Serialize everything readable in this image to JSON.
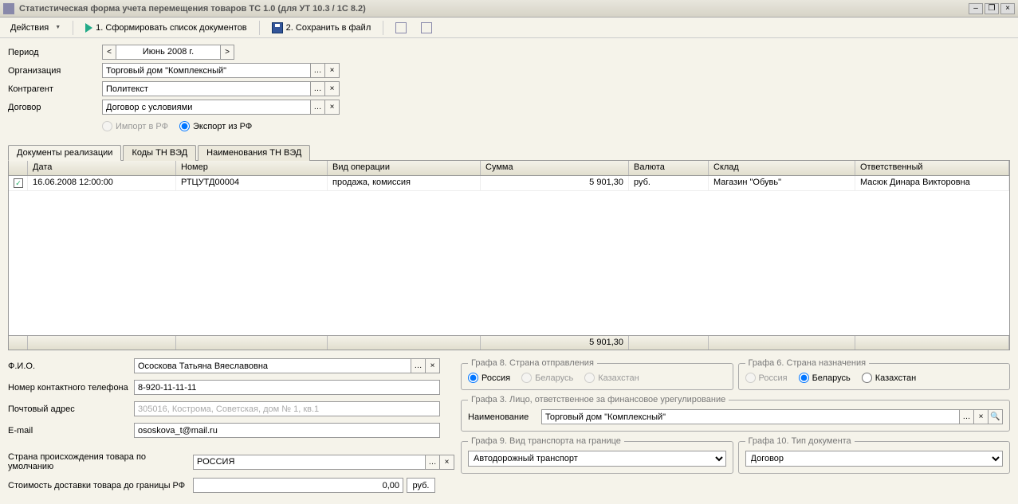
{
  "title": "Статистическая форма учета перемещения товаров ТС 1.0 (для УТ 10.3 / 1С 8.2)",
  "toolbar": {
    "actions": "Действия",
    "btn1": "1. Сформировать список документов",
    "btn2": "2. Сохранить в файл"
  },
  "period": {
    "label": "Период",
    "value": "Июнь 2008 г."
  },
  "org": {
    "label": "Организация",
    "value": "Торговый дом \"Комплексный\""
  },
  "contr": {
    "label": "Контрагент",
    "value": "Политекст"
  },
  "contract": {
    "label": "Договор",
    "value": "Договор с условиями"
  },
  "dir": {
    "import": "Импорт в РФ",
    "export": "Экспорт из РФ"
  },
  "tabs": {
    "t1": "Документы реализации",
    "t2": "Коды ТН ВЭД",
    "t3": "Наименования ТН ВЭД"
  },
  "grid": {
    "head": {
      "date": "Дата",
      "num": "Номер",
      "op": "Вид операции",
      "sum": "Сумма",
      "cur": "Валюта",
      "wh": "Склад",
      "resp": "Ответственный"
    },
    "row": {
      "date": "16.06.2008 12:00:00",
      "num": "РТЦУТД00004",
      "op": "продажа, комиссия",
      "sum": "5 901,30",
      "cur": "руб.",
      "wh": "Магазин \"Обувь\"",
      "resp": "Масюк Динара Викторовна"
    },
    "total": "5 901,30"
  },
  "contact": {
    "fio_l": "Ф.И.О.",
    "fio": "Ососкова Татьяна Вяеславовна",
    "phone_l": "Номер контактного телефона",
    "phone": "8-920-11-11-11",
    "addr_l": "Почтовый адрес",
    "addr_ph": "305016, Кострома, Советская, дом № 1, кв.1",
    "email_l": "E-mail",
    "email": "ososkova_t@mail.ru",
    "country_l": "Страна происхождения товара по умолчанию",
    "country": "РОССИЯ",
    "deliv_l": "Стоимость доставки товара до границы РФ",
    "deliv": "0,00",
    "deliv_cur": "руб."
  },
  "g8": {
    "legend": "Графа 8. Страна отправления",
    "ru": "Россия",
    "by": "Беларусь",
    "kz": "Казахстан"
  },
  "g6": {
    "legend": "Графа 6. Страна назначения",
    "ru": "Россия",
    "by": "Беларусь",
    "kz": "Казахстан"
  },
  "g3": {
    "legend": "Графа 3. Лицо, ответственное за финансовое урегулирование",
    "name_l": "Наименование",
    "name": "Торговый дом \"Комплексный\""
  },
  "g9": {
    "legend": "Графа 9. Вид транспорта на границе",
    "val": "Автодорожный транспорт"
  },
  "g10": {
    "legend": "Графа 10. Тип документа",
    "val": "Договор"
  }
}
